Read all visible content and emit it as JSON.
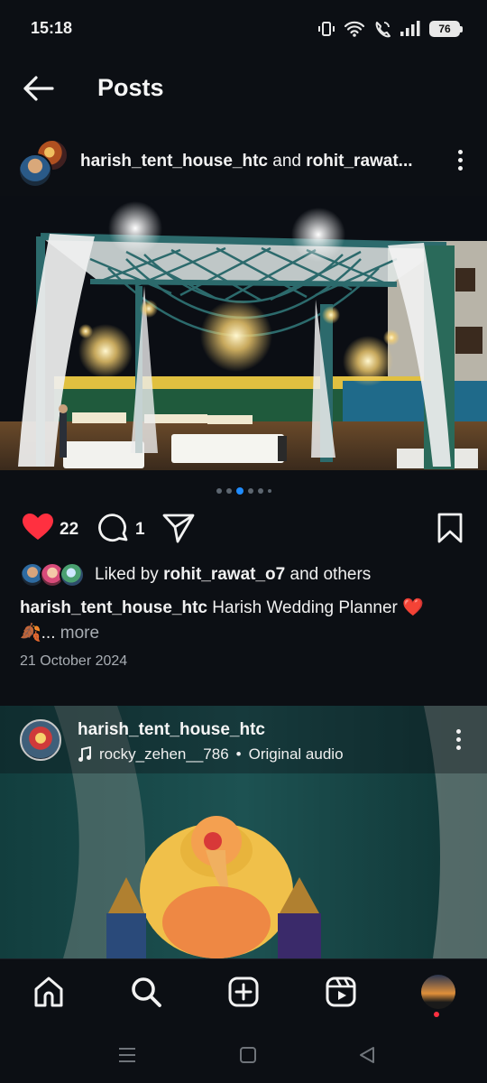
{
  "status_bar": {
    "time": "15:18",
    "battery": "76"
  },
  "header": {
    "title": "Posts"
  },
  "post1": {
    "user1": "harish_tent_house_htc",
    "connector": "and",
    "user2": "rohit_rawat...",
    "likes_count": "22",
    "comments_count": "1",
    "liked_by_prefix": "Liked by",
    "liked_by_user": "rohit_rawat_o7",
    "liked_by_suffix": "and others",
    "caption_user": "harish_tent_house_htc",
    "caption_text": "Harish Wedding Planner ❤️",
    "caption_line2": "🍂...",
    "more_label": "more",
    "date": "21 October 2024",
    "carousel": {
      "count": 6,
      "active_index": 2
    }
  },
  "post2": {
    "username": "harish_tent_house_htc",
    "audio_user": "rocky_zehen__786",
    "audio_separator": "•",
    "audio_label": "Original audio"
  },
  "bottom_nav": [
    "home-icon",
    "search-icon",
    "add-icon",
    "reels-icon",
    "profile-avatar"
  ],
  "colors": {
    "accent": "#1f8cff",
    "like": "#ff3040",
    "background": "#0c0f14"
  }
}
